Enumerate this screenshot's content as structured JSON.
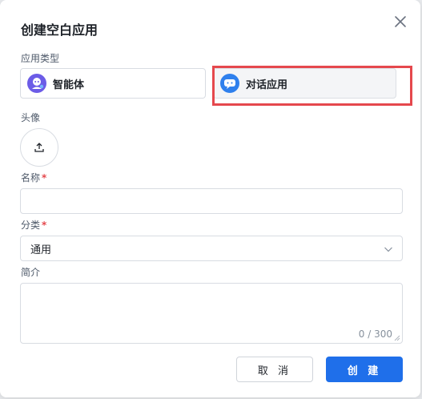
{
  "dialog": {
    "title": "创建空白应用",
    "close_icon": "close-icon"
  },
  "app_type": {
    "label": "应用类型",
    "options": [
      {
        "name": "智能体",
        "icon": "agent-robot-icon",
        "selected": false
      },
      {
        "name": "对话应用",
        "icon": "chat-bubble-icon",
        "selected": true
      }
    ]
  },
  "avatar": {
    "label": "头像",
    "icon": "upload-icon"
  },
  "name_field": {
    "label": "名称",
    "required_mark": "*",
    "value": ""
  },
  "category": {
    "label": "分类",
    "required_mark": "*",
    "selected": "通用"
  },
  "intro": {
    "label": "简介",
    "value": "",
    "counter": "0 / 300"
  },
  "buttons": {
    "cancel": "取 消",
    "create": "创 建"
  },
  "colors": {
    "primary": "#1f6fea",
    "highlight_border": "#e5484d",
    "required": "#e5484d"
  }
}
